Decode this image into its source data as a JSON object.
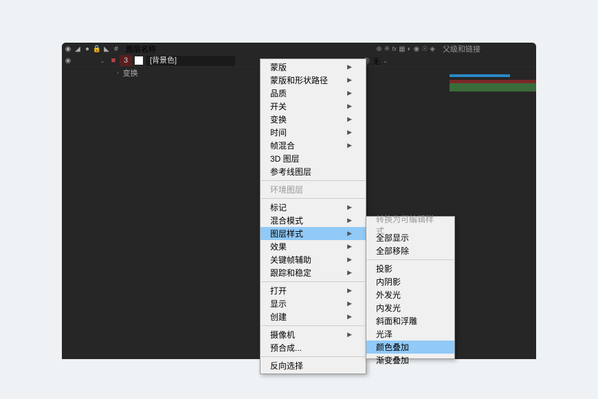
{
  "headers": {
    "layer_name": "图层名称",
    "parent_link": "父级和链接"
  },
  "layer": {
    "index": "3",
    "name": "[背景色]",
    "mode_none": "无"
  },
  "subrow": {
    "transform": "变换"
  },
  "menu1_items": [
    {
      "label": "蒙版",
      "arrow": true
    },
    {
      "label": "蒙版和形状路径",
      "arrow": true
    },
    {
      "label": "品质",
      "arrow": true
    },
    {
      "label": "开关",
      "arrow": true
    },
    {
      "label": "变换",
      "arrow": true
    },
    {
      "label": "时间",
      "arrow": true
    },
    {
      "label": "帧混合",
      "arrow": true
    },
    {
      "label": "3D 图层",
      "arrow": false
    },
    {
      "label": "参考线图层",
      "arrow": false
    },
    {
      "sep": true
    },
    {
      "label": "环境图层",
      "disabled": true
    },
    {
      "sep": true
    },
    {
      "label": "标记",
      "arrow": true
    },
    {
      "label": "混合模式",
      "arrow": true
    },
    {
      "label": "图层样式",
      "arrow": true,
      "hl": true
    },
    {
      "label": "效果",
      "arrow": true
    },
    {
      "label": "关键帧辅助",
      "arrow": true
    },
    {
      "label": "跟踪和稳定",
      "arrow": true
    },
    {
      "sep": true
    },
    {
      "label": "打开",
      "arrow": true
    },
    {
      "label": "显示",
      "arrow": true
    },
    {
      "label": "创建",
      "arrow": true
    },
    {
      "sep": true
    },
    {
      "label": "摄像机",
      "arrow": true
    },
    {
      "label": "预合成..."
    },
    {
      "sep": true
    },
    {
      "label": "反向选择"
    }
  ],
  "menu2_items": [
    {
      "label": "转换为可编辑样式",
      "disabled": true
    },
    {
      "label": "全部显示"
    },
    {
      "label": "全部移除"
    },
    {
      "sep": true
    },
    {
      "label": "投影"
    },
    {
      "label": "内阴影"
    },
    {
      "label": "外发光"
    },
    {
      "label": "内发光"
    },
    {
      "label": "斜面和浮雕"
    },
    {
      "label": "光泽"
    },
    {
      "label": "颜色叠加",
      "hl": true
    },
    {
      "label": "渐变叠加"
    }
  ]
}
